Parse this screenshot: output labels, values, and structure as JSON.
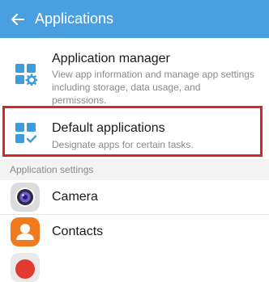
{
  "appbar": {
    "title": "Applications",
    "back_icon": "arrow-left-icon",
    "color": "#4a9fe0"
  },
  "menu": {
    "items": [
      {
        "title": "Application manager",
        "subtitle": "View app information and manage app settings including storage, data usage, and permissions.",
        "icon": "grid-gear-icon"
      },
      {
        "title": "Default applications",
        "subtitle": "Designate apps for certain tasks.",
        "icon": "grid-check-icon"
      }
    ]
  },
  "section": {
    "label": "Application settings"
  },
  "apps": [
    {
      "label": "Camera",
      "icon": "camera-icon"
    },
    {
      "label": "Contacts",
      "icon": "contacts-icon"
    }
  ],
  "colors": {
    "accent": "#4a9fe0",
    "highlight": "#d8262c",
    "contacts": "#f07a1e"
  }
}
